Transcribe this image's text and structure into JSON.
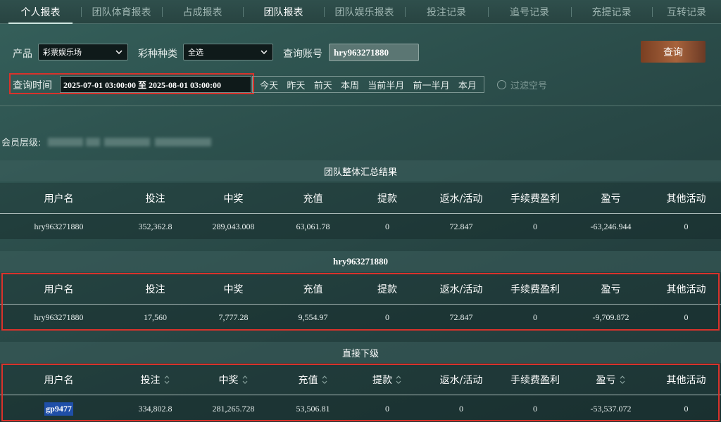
{
  "nav": {
    "tabs": [
      {
        "label": "个人报表"
      },
      {
        "label": "团队体育报表"
      },
      {
        "label": "占成报表"
      },
      {
        "label": "团队报表"
      },
      {
        "label": "团队娱乐报表"
      },
      {
        "label": "投注记录"
      },
      {
        "label": "追号记录"
      },
      {
        "label": "充提记录"
      },
      {
        "label": "互转记录"
      }
    ]
  },
  "filters": {
    "product_label": "产品",
    "product_value": "彩票娱乐场",
    "lottery_label": "彩种种类",
    "lottery_value": "全选",
    "account_label": "查询账号",
    "account_value": "hry963271880",
    "query_button": "查询",
    "time_label": "查询时间",
    "time_value": "2025-07-01 03:00:00 至 2025-08-01 03:00:00",
    "quick": [
      "今天",
      "昨天",
      "前天",
      "本周",
      "当前半月",
      "前一半月",
      "本月"
    ],
    "filter_empty_label": "过滤空号"
  },
  "member_level_label": "会员层级:",
  "columns": [
    "用户名",
    "投注",
    "中奖",
    "充值",
    "提款",
    "返水/活动",
    "手续费盈利",
    "盈亏",
    "其他活动"
  ],
  "sections": [
    {
      "title": "团队整体汇总结果",
      "row": [
        "hry963271880",
        "352,362.8",
        "289,043.008",
        "63,061.78",
        "0",
        "72.847",
        "0",
        "-63,246.944",
        "0"
      ]
    },
    {
      "title": "hry963271880",
      "row": [
        "hry963271880",
        "17,560",
        "7,777.28",
        "9,554.97",
        "0",
        "72.847",
        "0",
        "-9,709.872",
        "0"
      ]
    },
    {
      "title": "直接下级",
      "row": [
        "gp9477",
        "334,802.8",
        "281,265.728",
        "53,506.81",
        "0",
        "0",
        "0",
        "-53,537.072",
        "0"
      ]
    }
  ],
  "colors": {
    "accent_red": "#d9322b",
    "query_button": "#a7633c",
    "highlight_blue": "#1f4fa8"
  }
}
